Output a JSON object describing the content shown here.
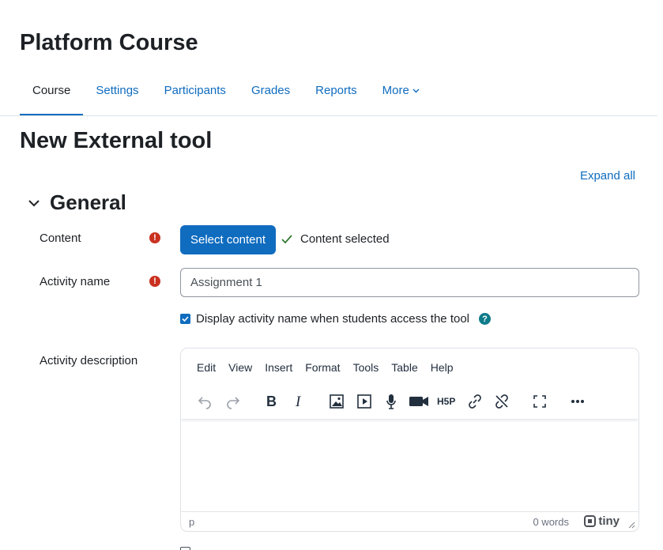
{
  "course": {
    "title": "Platform Course",
    "nav": [
      {
        "label": "Course",
        "active": true
      },
      {
        "label": "Settings"
      },
      {
        "label": "Participants"
      },
      {
        "label": "Grades"
      },
      {
        "label": "Reports"
      },
      {
        "label": "More"
      }
    ]
  },
  "page": {
    "title": "New External tool",
    "expand_all": "Expand all"
  },
  "section": {
    "title": "General"
  },
  "form": {
    "content": {
      "label": "Content",
      "button": "Select content",
      "status": "Content selected"
    },
    "activity_name": {
      "label": "Activity name",
      "value": "Assignment 1"
    },
    "display_name": {
      "label": "Display activity name when students access the tool",
      "checked": true
    },
    "description": {
      "label": "Activity description",
      "menu": [
        "Edit",
        "View",
        "Insert",
        "Format",
        "Tools",
        "Table",
        "Help"
      ],
      "toolbar": [
        "undo-icon",
        "redo-icon",
        "bold-icon",
        "italic-icon",
        "image-icon",
        "media-icon",
        "record-audio-icon",
        "record-video-icon",
        "h5p-icon",
        "link-icon",
        "unlink-icon",
        "fullscreen-icon",
        "more-icon"
      ],
      "path": "p",
      "word_count": "0 words",
      "brand": "tiny"
    }
  },
  "colors": {
    "primary": "#0f6cbf",
    "required": "#ca3120",
    "help": "#0f7b8a",
    "success": "#357a32"
  }
}
